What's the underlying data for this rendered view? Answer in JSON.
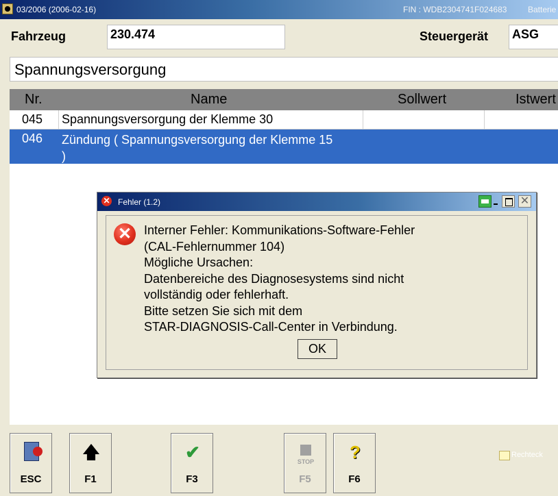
{
  "window": {
    "title": "03/2006 (2006-02-16)",
    "fin": "FIN : WDB2304741F024683",
    "battery": "Batterie"
  },
  "header": {
    "vehicle_label": "Fahrzeug",
    "vehicle_value": "230.474",
    "ecu_label": "Steuergerät",
    "ecu_value": "ASG",
    "section": "Spannungsversorgung"
  },
  "table": {
    "columns": [
      "Nr.",
      "Name",
      "Sollwert",
      "Istwert"
    ],
    "rows": [
      {
        "nr": "045",
        "name": "Spannungsversorgung der Klemme 30",
        "soll": "",
        "ist": ""
      },
      {
        "nr": "046",
        "name": "Zündung ( Spannungsversorgung der Klemme 15 )",
        "name_line1": "Zündung ( Spannungsversorgung der Klemme 15",
        "name_line2": ")",
        "soll": "",
        "ist": ""
      }
    ]
  },
  "dialog": {
    "title": "Fehler  (1.2)",
    "message_lines": [
      "Interner Fehler: Kommunikations-Software-Fehler",
      "(CAL-Fehlernummer 104)",
      "Mögliche Ursachen:",
      "Datenbereiche des Diagnosesystems sind nicht",
      "vollständig oder fehlerhaft.",
      "Bitte setzen Sie sich mit dem",
      "STAR-DIAGNOSIS-Call-Center in Verbindung."
    ],
    "ok_label": "OK"
  },
  "toolbar": {
    "esc": "ESC",
    "f1": "F1",
    "f3": "F3",
    "f5": "F5",
    "f5_icon_text": "STOP",
    "f6": "F6",
    "legend": "Rechteck"
  },
  "colors": {
    "selection": "#316ac5",
    "error": "#e0301e",
    "background": "#ece9d8"
  },
  "icons": {
    "esc": "exit-door-icon",
    "f1": "arrow-up-icon",
    "f3": "checkmark-icon",
    "f5": "stop-icon",
    "f6": "help-icon"
  }
}
